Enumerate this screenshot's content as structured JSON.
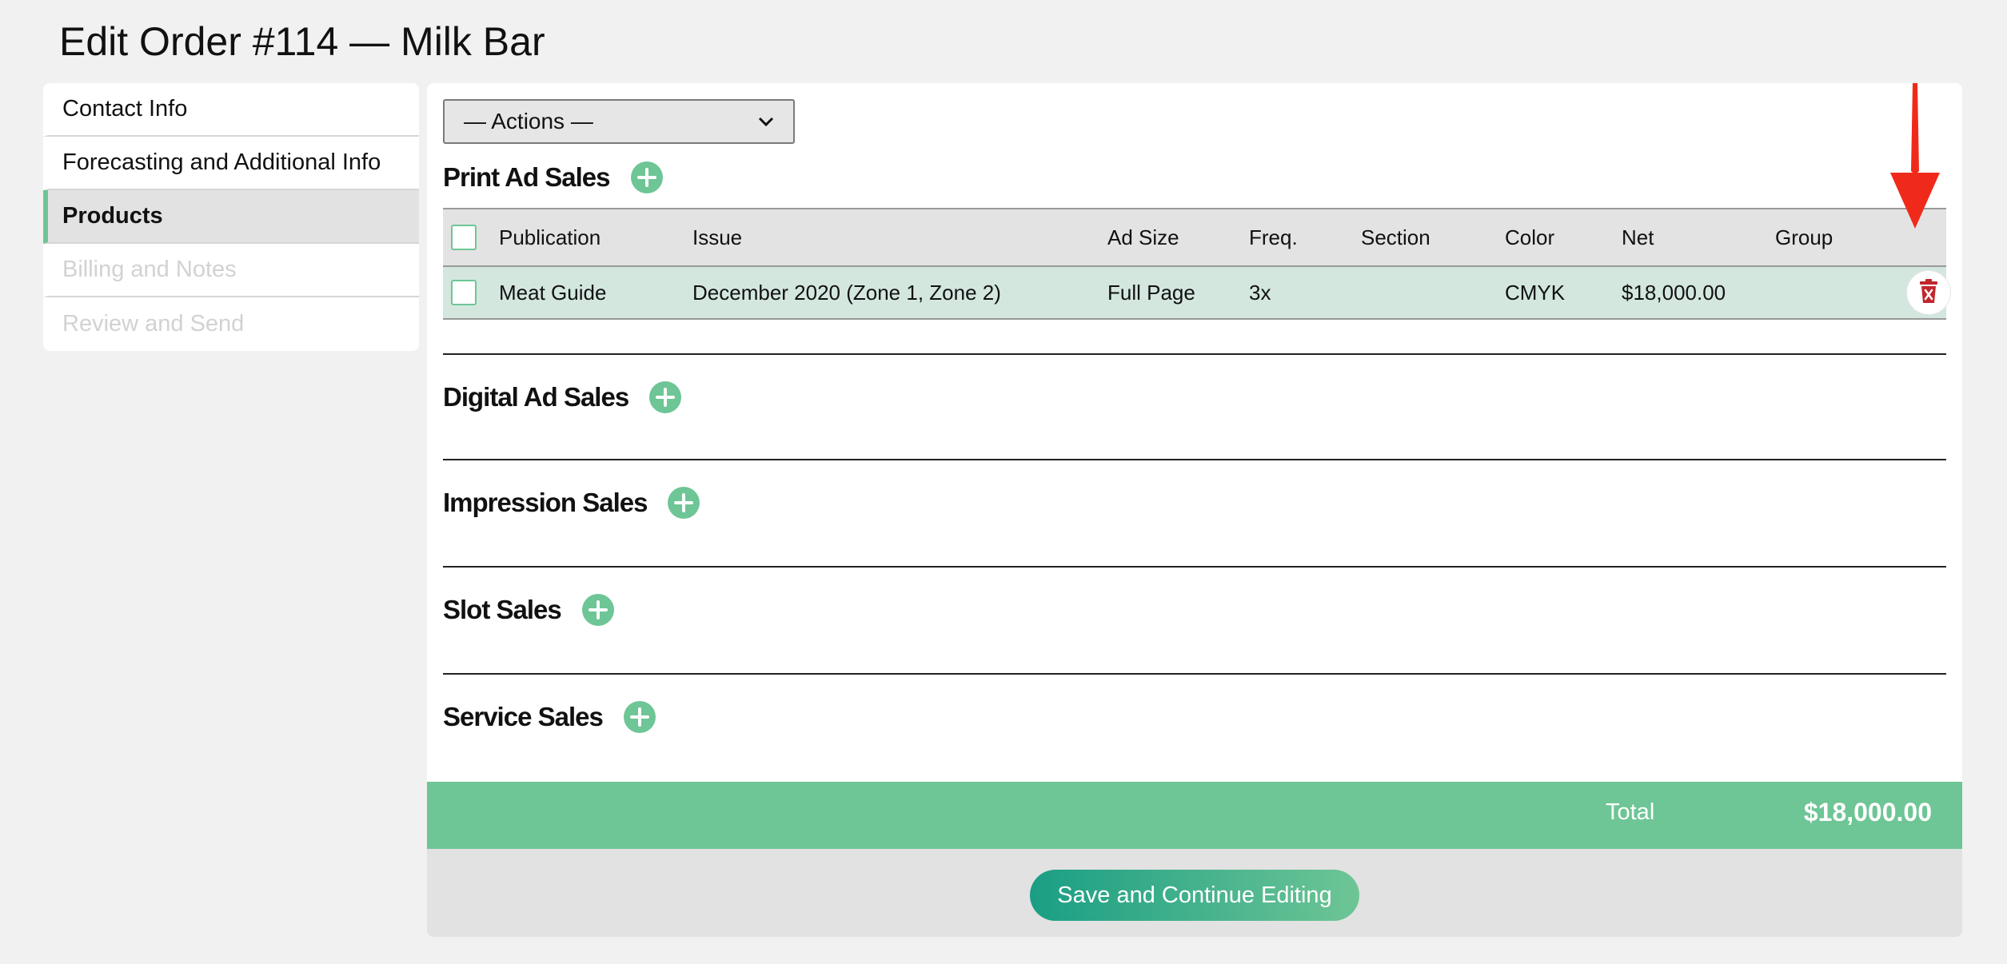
{
  "page": {
    "title": "Edit Order #114 — Milk Bar"
  },
  "sidebar": {
    "items": [
      {
        "label": "Contact Info"
      },
      {
        "label": "Forecasting and Additional Info"
      },
      {
        "label": "Products"
      },
      {
        "label": "Billing and Notes"
      },
      {
        "label": "Review and Send"
      }
    ]
  },
  "actions": {
    "selected": "— Actions —"
  },
  "sections": {
    "print": {
      "title": "Print Ad Sales"
    },
    "digital": {
      "title": "Digital Ad Sales"
    },
    "impression": {
      "title": "Impression Sales"
    },
    "slot": {
      "title": "Slot Sales"
    },
    "service": {
      "title": "Service Sales"
    }
  },
  "table": {
    "headers": [
      "Publication",
      "Issue",
      "Ad Size",
      "Freq.",
      "Section",
      "Color",
      "Net",
      "Group"
    ],
    "rows": [
      {
        "publication": "Meat Guide",
        "issue": "December 2020 (Zone 1, Zone 2)",
        "ad_size": "Full Page",
        "freq": "3x",
        "section": "",
        "color": "CMYK",
        "net": "$18,000.00",
        "group": ""
      }
    ]
  },
  "totals": {
    "label": "Total",
    "value": "$18,000.00"
  },
  "footer": {
    "save_label": "Save and Continue Editing"
  },
  "colors": {
    "accent": "#6ec595",
    "active_row": "#d3e7df",
    "annotation_arrow": "#f02a1a",
    "delete_icon": "#c0272d"
  }
}
